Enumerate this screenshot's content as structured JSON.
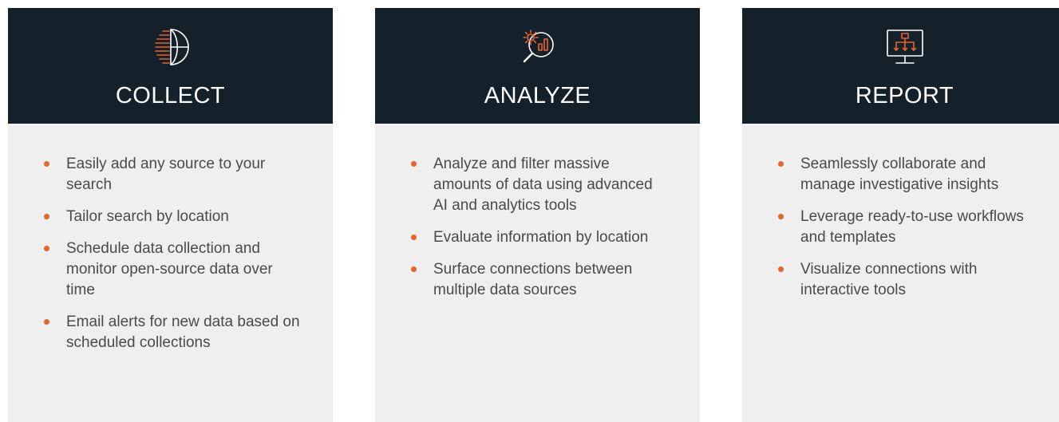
{
  "colors": {
    "header_bg": "#15212a",
    "body_bg": "#efefef",
    "accent": "#e8632a",
    "title_text": "#ffffff",
    "body_text": "#4a4a4a"
  },
  "cards": [
    {
      "icon": "globe-signal-icon",
      "title": "COLLECT",
      "items": [
        "Easily add any source to your search",
        "Tailor search by location",
        "Schedule data collection and monitor open-source data over time",
        "Email alerts for new data based on scheduled collections"
      ]
    },
    {
      "icon": "analytics-gear-magnifier-icon",
      "title": "ANALYZE",
      "items": [
        "Analyze and filter massive amounts of data using ad­vanced AI and analytics tools",
        "Evaluate information by location",
        "Surface connections between multiple data sources"
      ]
    },
    {
      "icon": "monitor-flowchart-icon",
      "title": "REPORT",
      "items": [
        "Seamlessly collaborate and manage investigative insights",
        "Leverage ready-to-use work­flows and templates",
        "Visualize connections with interactive tools"
      ]
    }
  ]
}
